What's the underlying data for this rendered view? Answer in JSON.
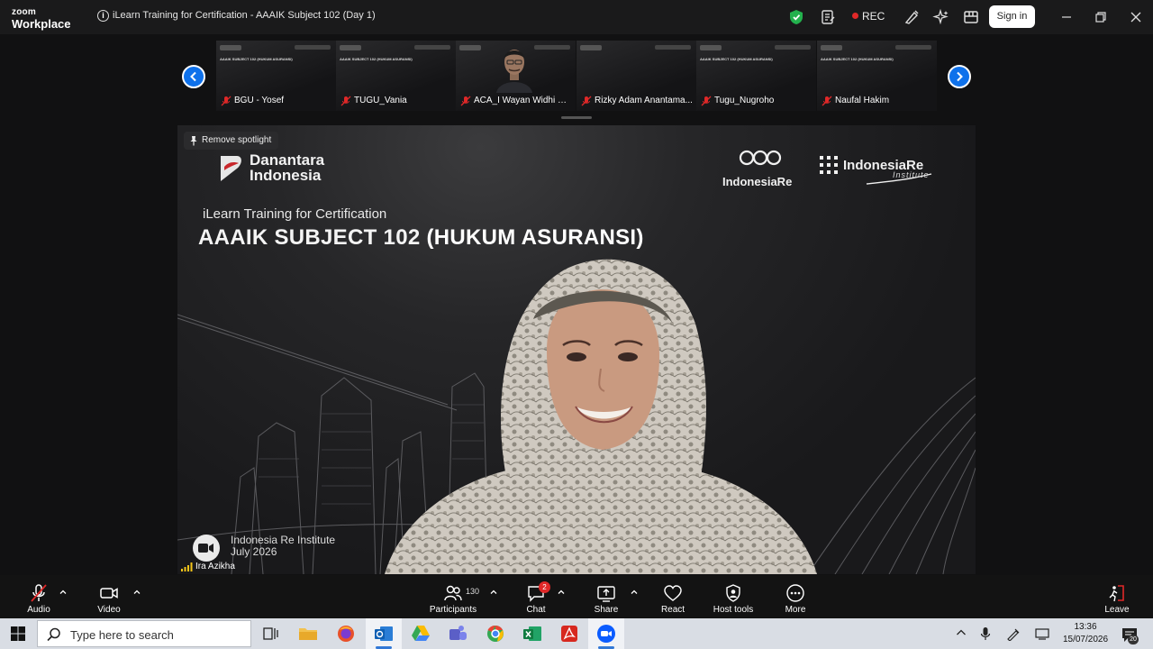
{
  "titlebar": {
    "brand_top": "zoom",
    "brand_bottom": "Workplace",
    "meeting_title": "iLearn Training for Certification - AAAIK Subject 102 (Day 1)",
    "rec_label": "REC",
    "signin_label": "Sign in"
  },
  "filmstrip": {
    "participants": [
      {
        "name": "BGU - Yosef"
      },
      {
        "name": "TUGU_Vania"
      },
      {
        "name": "ACA_I Wayan Widhi Di..."
      },
      {
        "name": "Rizky Adam Anantama..."
      },
      {
        "name": "Tugu_Nugroho"
      },
      {
        "name": "Naufal Hakim"
      }
    ],
    "mini_slide_title": "AAAIK SUBJECT 102 (HUKUM ASURANSI)"
  },
  "main": {
    "spotlight_label": "Remove spotlight",
    "slide_logo_line1": "Danantara",
    "slide_logo_line2": "Indonesia",
    "slide_subtitle": "iLearn Training for Certification",
    "slide_title_a": "AAAIK SUBJECT 102 ",
    "slide_title_b": "(HUKUM ASURANSI)",
    "indonesiare_label": "IndonesiaRe",
    "iri_label": "IndonesiaRe",
    "iri_sub": "Institute",
    "footer_line1": "Indonesia Re Institute",
    "footer_line2": "July 2026",
    "speaker_name": "Ira Azikha"
  },
  "toolbar": {
    "audio": "Audio",
    "video": "Video",
    "participants": "Participants",
    "participants_count": "130",
    "chat": "Chat",
    "chat_badge": "2",
    "share": "Share",
    "react": "React",
    "host_tools": "Host tools",
    "more": "More",
    "leave": "Leave"
  },
  "taskbar": {
    "search_placeholder": "Type here to search",
    "time": "13:36",
    "date": "15/07/2026",
    "notification_count": "20"
  },
  "colors": {
    "accent_blue": "#0e71eb",
    "rec_red": "#e02828",
    "shield_green": "#23b14d"
  }
}
